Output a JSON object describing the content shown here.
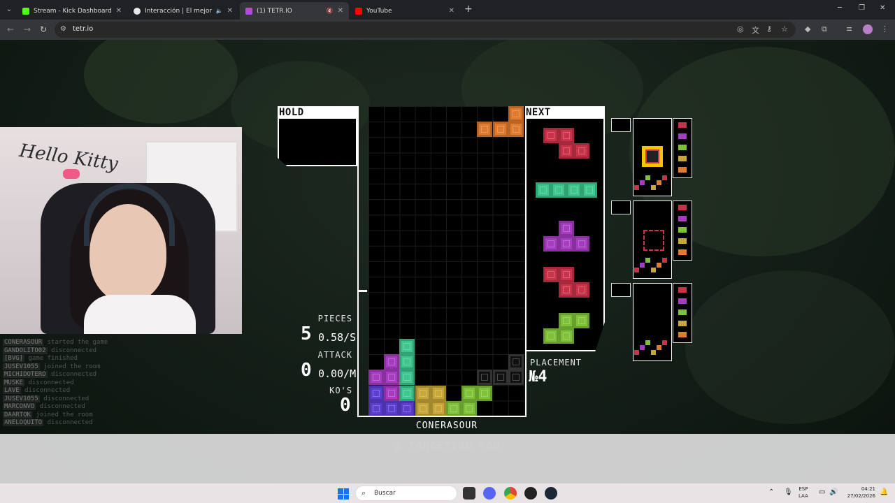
{
  "browser": {
    "tabs": [
      {
        "title": "Stream - Kick Dashboard",
        "favicon": "kick-icon",
        "color": "#53fc18"
      },
      {
        "title": "Interacción | El mejor softw",
        "favicon": "streamelements-icon",
        "color": "#e8e8e8"
      },
      {
        "title": "(1) TETR.IO",
        "favicon": "tetrio-icon",
        "color": "#b44bd6"
      },
      {
        "title": "YouTube",
        "favicon": "youtube-icon",
        "color": "#ff0000"
      }
    ],
    "new_tab": "+",
    "url": "tetr.io"
  },
  "chat": {
    "lines": [
      {
        "user": "CONERASOUR",
        "text": "started the game"
      },
      {
        "user": "GANDOLITO02",
        "text": "disconnected"
      },
      {
        "user": "[BVG]",
        "text": "game finished"
      },
      {
        "user": "JUSEV1055",
        "text": "joined the room"
      },
      {
        "user": "MICHIDOTERO",
        "text": "disconnected"
      },
      {
        "user": "MUSKE",
        "text": "disconnected"
      },
      {
        "user": "LAVE",
        "text": "disconnected"
      },
      {
        "user": "JUSEV1055",
        "text": "disconnected"
      },
      {
        "user": "MARCONVO",
        "text": "disconnected"
      },
      {
        "user": "DAARTOK",
        "text": "joined the room"
      },
      {
        "user": "ANELOQUITO",
        "text": "disconnected"
      }
    ]
  },
  "webcam": {
    "poster_text": "Hello Kitty"
  },
  "game": {
    "hold_label": "HOLD",
    "next_label": "NEXT",
    "stats": {
      "pieces_label": "PIECES",
      "pieces_value": "5",
      "pieces_rate": "0.58/S",
      "attack_label": "ATTACK",
      "attack_value": "0",
      "attack_rate": "0.00/M",
      "kos_label": "KO'S",
      "kos_value": "0"
    },
    "placement_label": "PLACEMENT",
    "placement_value": "№4",
    "player_name": "CONERASOUR",
    "targeting_text": "2 TARGETING YOU",
    "colors": {
      "Z": "#c8334a",
      "I": "#3ec68e",
      "T": "#a63cbf",
      "O": "#c7a63a",
      "L": "#e07a2e",
      "S": "#7fc23a",
      "J": "#5b3fd1",
      "G": "#3a3a3a"
    },
    "next_queue": [
      "Z",
      "I",
      "T",
      "Z",
      "S"
    ],
    "board_cells": [
      {
        "c": 9,
        "r": 0,
        "p": "L"
      },
      {
        "c": 7,
        "r": 1,
        "p": "L"
      },
      {
        "c": 8,
        "r": 1,
        "p": "L"
      },
      {
        "c": 9,
        "r": 1,
        "p": "L"
      },
      {
        "c": 2,
        "r": 15,
        "p": "I"
      },
      {
        "c": 1,
        "r": 16,
        "p": "T"
      },
      {
        "c": 2,
        "r": 16,
        "p": "I"
      },
      {
        "c": 0,
        "r": 17,
        "p": "T"
      },
      {
        "c": 1,
        "r": 17,
        "p": "T"
      },
      {
        "c": 2,
        "r": 17,
        "p": "I"
      },
      {
        "c": 0,
        "r": 18,
        "p": "J"
      },
      {
        "c": 1,
        "r": 18,
        "p": "T"
      },
      {
        "c": 2,
        "r": 18,
        "p": "I"
      },
      {
        "c": 3,
        "r": 18,
        "p": "O"
      },
      {
        "c": 4,
        "r": 18,
        "p": "O"
      },
      {
        "c": 6,
        "r": 18,
        "p": "S"
      },
      {
        "c": 7,
        "r": 18,
        "p": "S"
      },
      {
        "c": 0,
        "r": 19,
        "p": "J"
      },
      {
        "c": 1,
        "r": 19,
        "p": "J"
      },
      {
        "c": 2,
        "r": 19,
        "p": "J"
      },
      {
        "c": 3,
        "r": 19,
        "p": "O"
      },
      {
        "c": 4,
        "r": 19,
        "p": "O"
      },
      {
        "c": 5,
        "r": 19,
        "p": "S"
      },
      {
        "c": 6,
        "r": 19,
        "p": "S"
      },
      {
        "c": 9,
        "r": 16,
        "p": "G"
      },
      {
        "c": 7,
        "r": 17,
        "p": "G"
      },
      {
        "c": 8,
        "r": 17,
        "p": "G"
      },
      {
        "c": 9,
        "r": 17,
        "p": "G"
      }
    ]
  },
  "taskbar": {
    "search_placeholder": "Buscar",
    "lang_1": "ESP",
    "lang_2": "LAA",
    "time": "04:21",
    "date": "27/02/2026"
  }
}
